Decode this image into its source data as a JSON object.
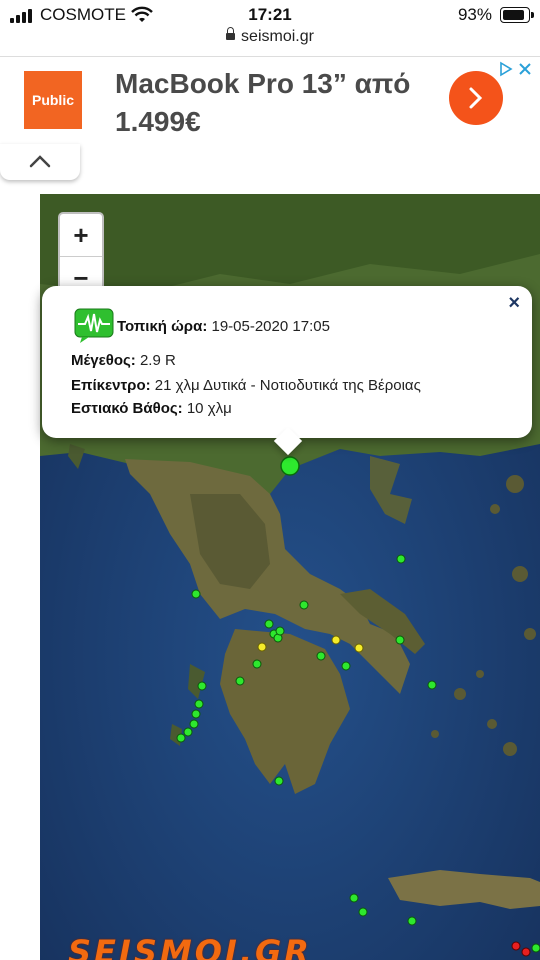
{
  "status_bar": {
    "carrier": "COSMOTE",
    "time": "17:21",
    "battery": "93%",
    "battery_level": 0.93
  },
  "browser": {
    "url": "seismoi.gr"
  },
  "ad": {
    "logo_text": "Public",
    "headline_line1": "MacBook Pro 13” από",
    "headline_line2": "1.499€",
    "accent_color": "#f4531a"
  },
  "map": {
    "zoom_in_label": "+",
    "zoom_out_label": "−",
    "wordmark": "SEISMOI.GR",
    "quake_colors": {
      "green": "#2ee82e",
      "yellow": "#f5ec2a",
      "red": "#e82020"
    }
  },
  "popup": {
    "close_label": "×",
    "local_time_label": "Τοπική ώρα:",
    "local_time_value": "19-05-2020 17:05",
    "magnitude_label": "Μέγεθος:",
    "magnitude_value": "2.9 R",
    "epicenter_label": "Επίκεντρο:",
    "epicenter_value": "21 χλμ Δυτικά - Νοτιοδυτικά της Βέροιας",
    "depth_label": "Εστιακό Βάθος:",
    "depth_value": "10 χλμ",
    "icon": "seismograph-icon"
  }
}
